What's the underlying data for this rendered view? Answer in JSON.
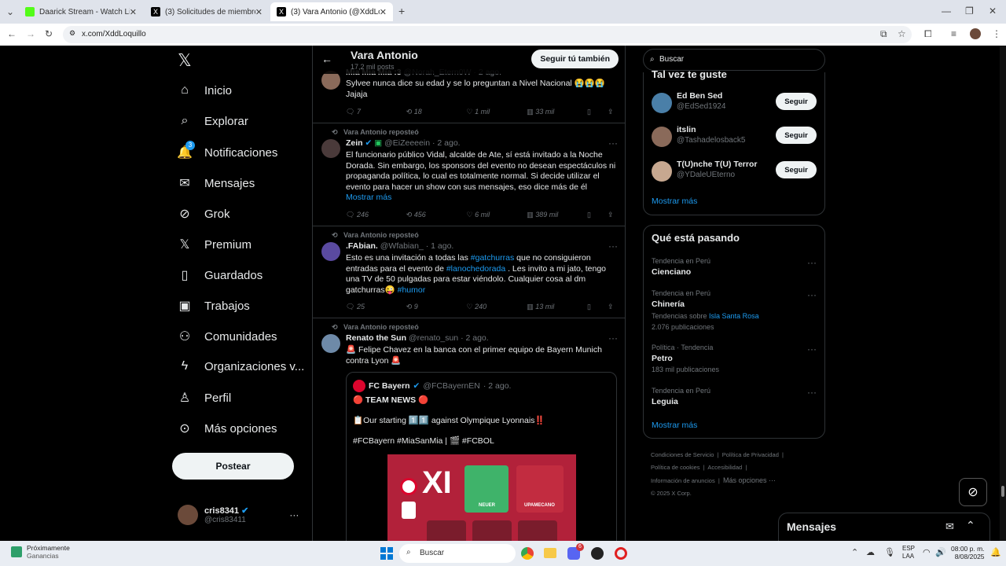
{
  "browser": {
    "tabs": [
      {
        "title": "Daarick Stream - Watch Live on"
      },
      {
        "title": "(3) Solicitudes de miembros / X"
      },
      {
        "title": "(3) Vara Antonio (@XddLoquill"
      }
    ],
    "new_tab": "+",
    "url": "x.com/XddLoquillo",
    "window_controls": {
      "minimize": "—",
      "restore": "❐",
      "close": "✕"
    }
  },
  "sidebar": {
    "logo": "𝕏",
    "items": [
      {
        "label": "Inicio",
        "icon": "home-icon",
        "glyph": "⌂"
      },
      {
        "label": "Explorar",
        "icon": "search-icon",
        "glyph": "⌕"
      },
      {
        "label": "Notificaciones",
        "icon": "bell-icon",
        "glyph": "🔔"
      },
      {
        "label": "Mensajes",
        "icon": "mail-icon",
        "glyph": "✉"
      },
      {
        "label": "Grok",
        "icon": "grok-icon",
        "glyph": "⊘"
      },
      {
        "label": "Premium",
        "icon": "x-icon",
        "glyph": "𝕏"
      },
      {
        "label": "Guardados",
        "icon": "bookmark-icon",
        "glyph": "🔖"
      },
      {
        "label": "Trabajos",
        "icon": "briefcase-icon",
        "glyph": "💼"
      },
      {
        "label": "Comunidades",
        "icon": "people-icon",
        "glyph": "👥"
      },
      {
        "label": "Organizaciones v...",
        "icon": "lightning-icon",
        "glyph": "ϟ"
      },
      {
        "label": "Perfil",
        "icon": "person-icon",
        "glyph": "👤"
      },
      {
        "label": "Más opciones",
        "icon": "more-circle-icon",
        "glyph": "⊙"
      }
    ],
    "notif_badge": "3",
    "post_button": "Postear",
    "account": {
      "name": "cris8341",
      "handle": "@cris83411",
      "more": "···"
    }
  },
  "profile_header": {
    "back": "←",
    "name": "Vara Antonio",
    "posts": "17,2 mil posts",
    "follow_back": "Seguir tú también"
  },
  "tweets": [
    {
      "name": "Mia Mia Mia :3",
      "handle": "@Norah_Etern0W",
      "time": "· 2 ago.",
      "text": "Sylvee nunca dice su edad y se lo preguntan a Nivel Nacional 😭😭😭 Jajaja",
      "replies": "7",
      "reposts": "18",
      "likes": "1 mil",
      "views": "33 mil"
    },
    {
      "context": "Vara Antonio reposteó",
      "name": "Zein",
      "handle": "@EiZeeeein",
      "time": "· 2 ago.",
      "text": "El funcionario público Vidal, alcalde de Ate, sí está invitado a la Noche Dorada. Sin embargo, los sponsors del evento no desean espectáculos ni propaganda política, lo cual es totalmente normal. Si decide utilizar el evento para hacer un show con sus mensajes, eso dice más de él",
      "show_more": "Mostrar más",
      "replies": "246",
      "reposts": "456",
      "likes": "6 mil",
      "views": "389 mil"
    },
    {
      "context": "Vara Antonio reposteó",
      "name": ".FAbian.",
      "handle": "@Wfabian_",
      "time": "· 1 ago.",
      "text_1": "Esto es una invitación a todas las ",
      "tag_1": "#gatchurras",
      "text_2": " que no consiguieron entradas para el evento de ",
      "tag_2": "#lanochedorada",
      "text_3": " . Les invito a mi jato, tengo una TV de 50 pulgadas para estar viéndolo. Cualquier cosa al dm gatchurras😜 ",
      "tag_3": "#humor",
      "replies": "25",
      "reposts": "9",
      "likes": "240",
      "views": "13 mil"
    },
    {
      "context": "Vara Antonio reposteó",
      "name": "Renato the Sun",
      "handle": "@renato_sun",
      "time": "· 2 ago.",
      "text": "🚨 Felipe Chavez en la banca con el primer equipo de Bayern Munich contra Lyon 🚨",
      "quote": {
        "name": "FC Bayern",
        "handle": "@FCBayernEN",
        "time": "· 2 ago.",
        "line1": "🔴 TEAM NEWS 🔴",
        "line2": "📋Our starting 1️⃣1️⃣ against Olympique Lyonnais‼️",
        "line3": "#FCBayern #MiaSanMia | 🎬 #FCBOL",
        "image_text": "XI",
        "players": [
          "NEUER",
          "UPAMECANO"
        ]
      }
    }
  ],
  "right": {
    "search_placeholder": "Buscar",
    "who_to_follow": {
      "title": "Tal vez te guste",
      "users": [
        {
          "name": "Ed Ben Sed",
          "handle": "@EdSed1924",
          "button": "Seguir"
        },
        {
          "name": "itslin",
          "handle": "@Tashadelosback5",
          "button": "Seguir"
        },
        {
          "name": "T(U)nche T(U) Terror",
          "handle": "@YDaleUEterno",
          "button": "Seguir"
        }
      ],
      "show_more": "Mostrar más"
    },
    "trends": {
      "title": "Qué está pasando",
      "items": [
        {
          "context": "Tendencia en Perú",
          "name": "Cienciano"
        },
        {
          "context": "Tendencia en Perú",
          "name": "Chinería",
          "extra_prefix": "Tendencias sobre ",
          "extra_link": "Isla Santa Rosa",
          "count": "2.076 publicaciones"
        },
        {
          "context": "Política · Tendencia",
          "name": "Petro",
          "count": "183 mil publicaciones"
        },
        {
          "context": "Tendencia en Perú",
          "name": "Leguia"
        }
      ],
      "show_more": "Mostrar más"
    },
    "footer": {
      "links": [
        "Condiciones de Servicio",
        "Política de Privacidad",
        "Política de cookies",
        "Accesibilidad",
        "Información de anuncios",
        "Más opciones ···"
      ],
      "copyright": "© 2025 X Corp."
    }
  },
  "messages_drawer": {
    "title": "Mensajes"
  },
  "taskbar": {
    "widget_title": "Próximamente",
    "widget_sub": "Ganancias",
    "search": "Buscar",
    "lang_1": "ESP",
    "lang_2": "LAA",
    "time": "08:00 p. m.",
    "date": "8/08/2025",
    "discord_badge": "6"
  }
}
